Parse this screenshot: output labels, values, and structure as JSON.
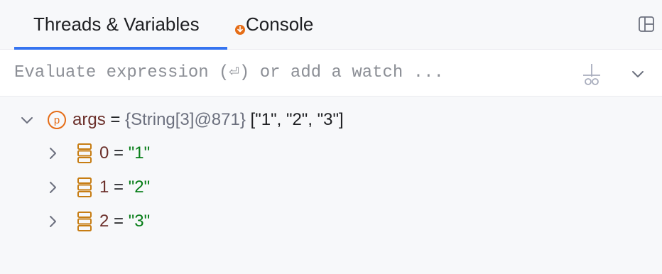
{
  "tabs": {
    "threads_label": "Threads & Variables",
    "console_label": "Console"
  },
  "evaluate": {
    "placeholder": "Evaluate expression (⏎) or add a watch ..."
  },
  "variables": {
    "root": {
      "name": "args",
      "equals": "=",
      "type": "{String[3]@871}",
      "value": "[\"1\", \"2\", \"3\"]",
      "icon": "parameter-icon",
      "expanded": true
    },
    "children": [
      {
        "name": "0",
        "equals": "=",
        "value": "\"1\"",
        "icon": "array-element-icon"
      },
      {
        "name": "1",
        "equals": "=",
        "value": "\"2\"",
        "icon": "array-element-icon"
      },
      {
        "name": "2",
        "equals": "=",
        "value": "\"3\"",
        "icon": "array-element-icon"
      }
    ]
  },
  "colors": {
    "accent": "#3574f0",
    "badge": "#e56d17",
    "string": "#067d17",
    "var_name": "#6b2f2a",
    "type": "#6c707e",
    "icon_orange": "#c77d13"
  }
}
